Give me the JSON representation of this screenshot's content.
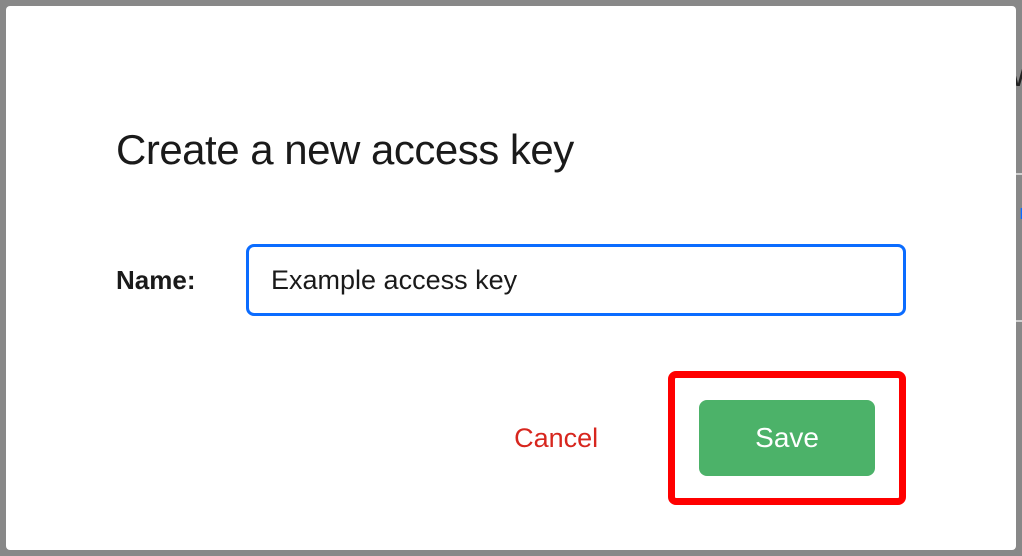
{
  "modal": {
    "title": "Create a new access key",
    "name_label": "Name:",
    "name_value": "Example access key",
    "cancel_label": "Cancel",
    "save_label": "Save"
  },
  "background": {
    "partial_text_1": "W",
    "partial_text_2": "r"
  }
}
